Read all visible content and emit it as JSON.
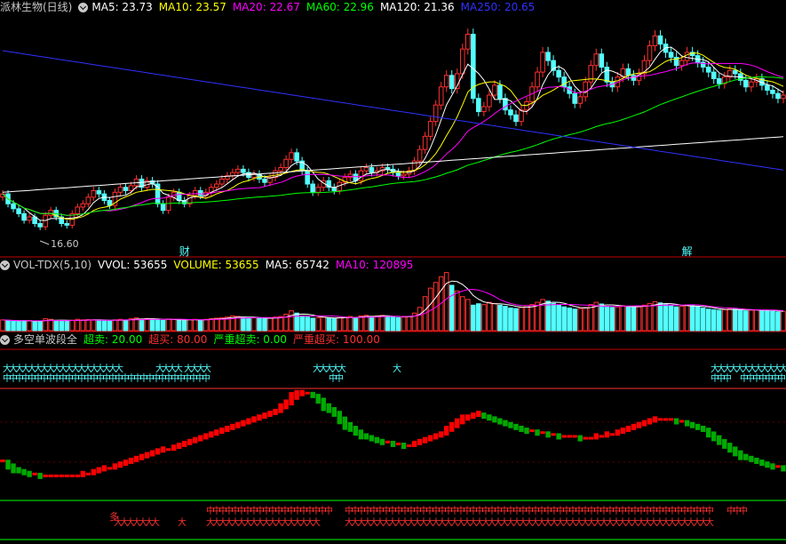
{
  "colors": {
    "bg": "#000000",
    "up": "#ff3030",
    "down": "#54ffff",
    "ma5": "#ffffff",
    "ma10": "#ffff00",
    "ma20": "#ff00ff",
    "ma60": "#00ff00",
    "ma120": "#ffffff",
    "ma250": "#3030ff",
    "sep": "#c00000",
    "cyanText": "#54ffff",
    "redText": "#ff3030",
    "greenText": "#00ff00",
    "wave_up": "#ff0000",
    "wave_down": "#00aa00"
  },
  "price_panel": {
    "title": "派林生物(日线)",
    "ma_labels": [
      {
        "text": "MA5: 23.73",
        "color": "#ffffff"
      },
      {
        "text": "MA10: 23.57",
        "color": "#ffff00"
      },
      {
        "text": "MA20: 22.67",
        "color": "#ff00ff"
      },
      {
        "text": "MA60: 22.96",
        "color": "#00ff00"
      },
      {
        "text": "MA120: 21.36",
        "color": "#ffffff"
      },
      {
        "text": "MA250: 20.65",
        "color": "#3030ff"
      }
    ],
    "low_label": "16.60",
    "markers": [
      {
        "text": "财",
        "bar": 34
      },
      {
        "text": "解",
        "bar": 128
      }
    ]
  },
  "vol_panel": {
    "labels": [
      {
        "text": "VOL-TDX(5,10)",
        "color": "#c8c8c8"
      },
      {
        "text": "VVOL: 53655",
        "color": "#ffffff"
      },
      {
        "text": "VOLUME: 53655",
        "color": "#ffff00"
      },
      {
        "text": "MA5: 65742",
        "color": "#ffffff"
      },
      {
        "text": "MA10: 120895",
        "color": "#ff00ff"
      }
    ]
  },
  "wave_panel": {
    "labels": [
      {
        "text": "多空单波段全",
        "color": "#c8c8c8"
      },
      {
        "text": "超卖: 20.00",
        "color": "#00ff00"
      },
      {
        "text": "超买: 80.00",
        "color": "#ff3030"
      },
      {
        "text": "严重超卖: 0.00",
        "color": "#00ff00"
      },
      {
        "text": "严重超买: 100.00",
        "color": "#ff3030"
      }
    ],
    "sig_da": "大",
    "sig_zhong": "中",
    "sig_duo": "多"
  },
  "chart_data": {
    "type": "candlestick",
    "x": [
      0,
      1,
      2,
      3,
      4,
      5,
      6,
      7,
      8,
      9,
      10,
      11,
      12,
      13,
      14,
      15,
      16,
      17,
      18,
      19,
      20,
      21,
      22,
      23,
      24,
      25,
      26,
      27,
      28,
      29,
      30,
      31,
      32,
      33,
      34,
      35,
      36,
      37,
      38,
      39,
      40,
      41,
      42,
      43,
      44,
      45,
      46,
      47,
      48,
      49,
      50,
      51,
      52,
      53,
      54,
      55,
      56,
      57,
      58,
      59,
      60,
      61,
      62,
      63,
      64,
      65,
      66,
      67,
      68,
      69,
      70,
      71,
      72,
      73,
      74,
      75,
      76,
      77,
      78,
      79,
      80,
      81,
      82,
      83,
      84,
      85,
      86,
      87,
      88,
      89,
      90,
      91,
      92,
      93,
      94,
      95,
      96,
      97,
      98,
      99,
      100,
      101,
      102,
      103,
      104,
      105,
      106,
      107,
      108,
      109,
      110,
      111,
      112,
      113,
      114,
      115,
      116,
      117,
      118,
      119,
      120,
      121,
      122,
      123,
      124,
      125,
      126,
      127,
      128,
      129,
      130,
      131,
      132,
      133,
      134,
      135,
      136,
      137,
      138,
      139,
      140,
      141,
      142,
      143,
      144,
      145,
      146
    ],
    "series": [
      {
        "name": "close",
        "values": [
          18.8,
          18.2,
          17.9,
          17.6,
          17.2,
          17.4,
          17.0,
          16.8,
          17.5,
          17.8,
          17.4,
          17.0,
          16.9,
          17.6,
          18.0,
          18.2,
          18.6,
          19.0,
          18.8,
          18.4,
          18.1,
          18.9,
          19.2,
          19.0,
          19.3,
          19.7,
          19.2,
          19.6,
          19.4,
          18.2,
          17.8,
          18.6,
          18.9,
          18.4,
          18.2,
          18.7,
          19.0,
          18.7,
          18.9,
          19.2,
          19.4,
          19.7,
          19.9,
          20.1,
          20.3,
          20.1,
          19.8,
          20.0,
          19.7,
          19.5,
          19.8,
          20.2,
          20.4,
          20.9,
          21.3,
          20.8,
          20.2,
          19.4,
          18.9,
          19.2,
          19.6,
          19.2,
          19.0,
          19.5,
          19.8,
          20.0,
          19.6,
          20.2,
          20.4,
          20.1,
          20.2,
          20.4,
          20.3,
          20.1,
          19.9,
          20.0,
          20.2,
          20.8,
          21.5,
          22.3,
          23.2,
          24.2,
          25.3,
          26.0,
          25.2,
          26.1,
          27.6,
          28.5,
          24.6,
          23.8,
          24.1,
          24.8,
          25.4,
          24.6,
          23.9,
          23.6,
          23.2,
          23.9,
          24.4,
          25.3,
          26.2,
          27.4,
          26.9,
          26.3,
          25.9,
          25.3,
          24.9,
          24.3,
          24.7,
          25.6,
          26.6,
          27.3,
          26.5,
          25.6,
          25.3,
          25.9,
          26.4,
          26.0,
          25.7,
          26.1,
          26.9,
          27.8,
          28.4,
          27.9,
          27.4,
          27.1,
          26.6,
          26.9,
          27.4,
          27.2,
          26.8,
          26.5,
          26.2,
          25.8,
          25.5,
          25.9,
          26.3,
          26.1,
          25.7,
          25.3,
          25.6,
          25.8,
          25.4,
          25.1,
          24.9,
          24.6,
          24.8
        ],
        "color": "#ff3030"
      },
      {
        "name": "volume",
        "values": [
          38,
          36,
          34,
          33,
          35,
          36,
          32,
          34,
          42,
          40,
          36,
          34,
          33,
          37,
          40,
          38,
          39,
          38,
          37,
          36,
          34,
          38,
          40,
          38,
          42,
          45,
          40,
          43,
          42,
          38,
          36,
          41,
          40,
          37,
          35,
          39,
          40,
          38,
          40,
          42,
          44,
          46,
          48,
          52,
          50,
          46,
          44,
          46,
          44,
          42,
          44,
          48,
          50,
          58,
          70,
          62,
          52,
          48,
          44,
          46,
          48,
          44,
          42,
          46,
          48,
          50,
          46,
          52,
          54,
          50,
          52,
          54,
          52,
          48,
          46,
          48,
          50,
          62,
          82,
          120,
          150,
          170,
          190,
          205,
          160,
          140,
          120,
          110,
          90,
          95,
          92,
          100,
          96,
          90,
          86,
          80,
          78,
          82,
          88,
          92,
          100,
          110,
          104,
          96,
          90,
          84,
          80,
          76,
          78,
          82,
          92,
          100,
          94,
          86,
          82,
          84,
          88,
          86,
          82,
          84,
          90,
          96,
          102,
          98,
          92,
          88,
          84,
          86,
          90,
          88,
          84,
          80,
          76,
          74,
          72,
          74,
          78,
          76,
          72,
          70,
          72,
          74,
          72,
          70,
          68,
          66,
          68
        ],
        "color": "#54ffff"
      },
      {
        "name": "wave",
        "values": [
          22,
          20,
          18,
          17,
          16,
          15,
          15,
          14,
          14,
          14,
          14,
          14,
          14,
          14,
          14,
          15,
          15,
          16,
          17,
          18,
          18,
          19,
          20,
          21,
          22,
          23,
          24,
          25,
          26,
          27,
          28,
          28,
          29,
          30,
          31,
          32,
          33,
          34,
          35,
          36,
          37,
          38,
          39,
          40,
          41,
          42,
          43,
          44,
          45,
          46,
          47,
          48,
          50,
          52,
          55,
          57,
          58,
          58,
          57,
          55,
          52,
          50,
          48,
          45,
          42,
          40,
          38,
          36,
          35,
          34,
          33,
          32,
          32,
          31,
          31,
          30,
          30,
          31,
          32,
          33,
          34,
          35,
          36,
          38,
          40,
          42,
          44,
          45,
          46,
          47,
          46,
          45,
          44,
          43,
          42,
          41,
          40,
          39,
          38,
          38,
          37,
          37,
          36,
          36,
          35,
          35,
          35,
          35,
          34,
          34,
          34,
          35,
          35,
          36,
          36,
          37,
          38,
          39,
          40,
          41,
          42,
          43,
          44,
          44,
          44,
          44,
          43,
          43,
          42,
          41,
          40,
          39,
          37,
          35,
          33,
          31,
          29,
          27,
          25,
          24,
          23,
          22,
          21,
          20,
          19,
          19,
          18
        ],
        "color": "#00aa00"
      }
    ]
  }
}
